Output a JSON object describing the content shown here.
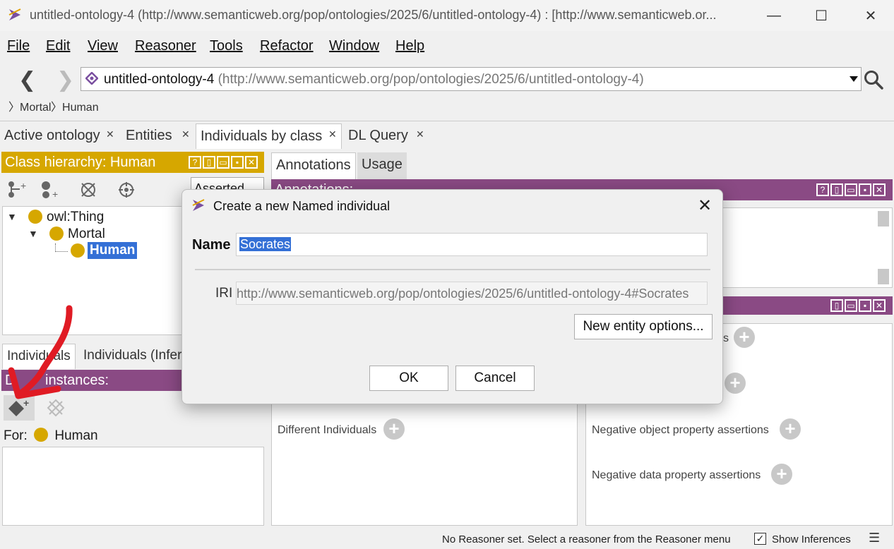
{
  "window": {
    "title": "untitled-ontology-4 (http://www.semanticweb.org/pop/ontologies/2025/6/untitled-ontology-4)  : [http://www.semanticweb.or...",
    "minimize": "—",
    "maximize": "☐",
    "close": "✕"
  },
  "menu": {
    "file": "File",
    "edit": "Edit",
    "view": "View",
    "reasoner": "Reasoner",
    "tools": "Tools",
    "refactor": "Refactor",
    "window": "Window",
    "help": "Help"
  },
  "nav": {
    "back": "❮",
    "forward": "❯",
    "ontology_name": "untitled-ontology-4",
    "ontology_iri": "(http://www.semanticweb.org/pop/ontologies/2025/6/untitled-ontology-4)",
    "breadcrumb": [
      "Mortal",
      "Human"
    ]
  },
  "tabs": [
    {
      "label": "Active ontology"
    },
    {
      "label": "Entities"
    },
    {
      "label": "Individuals by class"
    },
    {
      "label": "DL Query"
    }
  ],
  "class_hierarchy": {
    "header": "Class hierarchy: Human",
    "asserted": "Asserted",
    "tree": [
      "owl:Thing",
      "Mortal",
      "Human"
    ]
  },
  "individuals_tabs": [
    "Individuals",
    "Individuals (Infer"
  ],
  "direct_instances": {
    "header_visible": "D",
    "header_rest": "instances:",
    "for_label": "For:",
    "for_class": "Human"
  },
  "right_tabs": [
    "Annotations",
    "Usage"
  ],
  "annotations": {
    "header": "Annotations:"
  },
  "description_sections": {
    "different_individuals": "Different Individuals",
    "right_partial_1": "s",
    "negative_object": "Negative object property assertions",
    "negative_data": "Negative data property assertions"
  },
  "dialog": {
    "title": "Create a new Named individual",
    "name_label": "Name",
    "name_value": "Socrates",
    "iri_label": "IRI",
    "iri_value": "http://www.semanticweb.org/pop/ontologies/2025/6/untitled-ontology-4#Socrates",
    "options_button": "New entity options...",
    "ok_button": "OK",
    "cancel_button": "Cancel"
  },
  "status": {
    "message": "No Reasoner set. Select a reasoner from the Reasoner menu",
    "show_inferences": "Show Inferences",
    "show_inferences_checked": true
  },
  "colors": {
    "gold": "#d6a700",
    "purple": "#8a4a84",
    "selection": "#3470d6",
    "annotation_arrow": "#e01b24"
  }
}
